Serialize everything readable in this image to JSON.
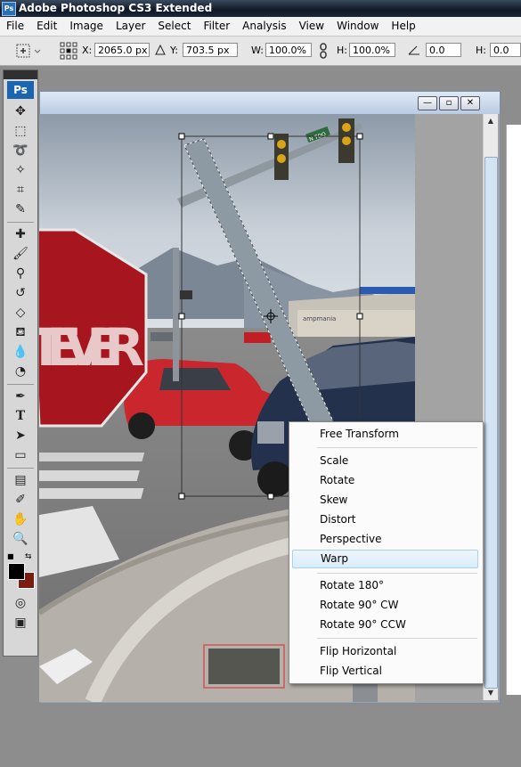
{
  "window": {
    "title": "Adobe Photoshop CS3 Extended",
    "app_icon": "Ps"
  },
  "menu": [
    "File",
    "Edit",
    "Image",
    "Layer",
    "Select",
    "Filter",
    "Analysis",
    "View",
    "Window",
    "Help"
  ],
  "options": {
    "x_label": "X:",
    "x_value": "2065.0 px",
    "y_label": "Y:",
    "y_value": "703.5 px",
    "w_label": "W:",
    "w_value": "100.0%",
    "h_label": "H:",
    "h_value": "100.0%",
    "angle_value": "0.0",
    "h2_label": "H:",
    "h2_value": "0.0"
  },
  "toolbox": {
    "logo": "Ps",
    "tools": [
      "move-tool",
      "marquee-tool",
      "lasso-tool",
      "magic-wand-tool",
      "crop-tool",
      "eyedropper-tool",
      "healing-brush-tool",
      "brush-tool",
      "clone-stamp-tool",
      "history-brush-tool",
      "eraser-tool",
      "paint-bucket-tool",
      "blur-tool",
      "dodge-tool",
      "pen-tool",
      "type-tool",
      "path-selection-tool",
      "shape-tool",
      "notes-tool",
      "eyedropper2-tool",
      "hand-tool",
      "zoom-tool"
    ],
    "fg_color": "#000000",
    "bg_color": "#7a1c12"
  },
  "context_menu": {
    "items": [
      {
        "label": "Free Transform"
      },
      {
        "label": "Scale"
      },
      {
        "label": "Rotate"
      },
      {
        "label": "Skew"
      },
      {
        "label": "Distort"
      },
      {
        "label": "Perspective"
      },
      {
        "label": "Warp",
        "highlighted": true
      },
      {
        "label": "Rotate 180°"
      },
      {
        "label": "Rotate 90° CW"
      },
      {
        "label": "Rotate 90° CCW"
      },
      {
        "label": "Flip Horizontal"
      },
      {
        "label": "Flip Vertical"
      }
    ]
  },
  "photo": {
    "sign_text": "TEVER",
    "street_sign_text": "N TOO",
    "station_text": "ampmania"
  }
}
